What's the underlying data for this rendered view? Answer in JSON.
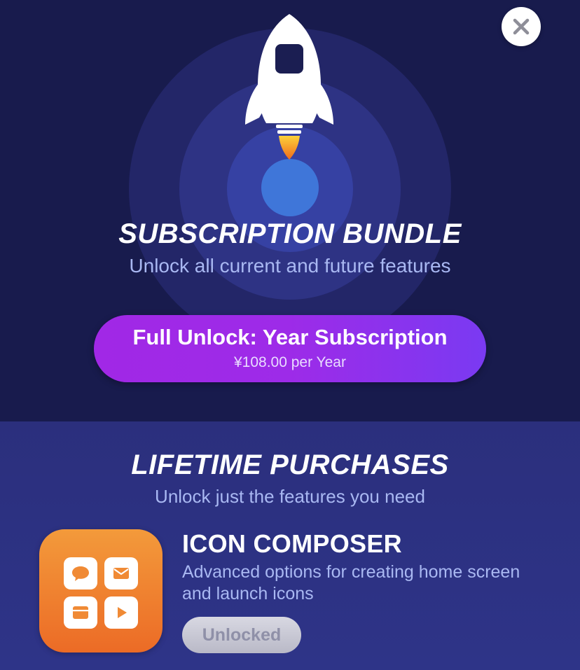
{
  "subscription": {
    "title": "SUBSCRIPTION BUNDLE",
    "subtitle": "Unlock all current and future features",
    "button_label": "Full Unlock: Year Subscription",
    "button_price": "¥108.00 per Year"
  },
  "lifetime": {
    "title": "LIFETIME PURCHASES",
    "subtitle": "Unlock just the features you need",
    "products": [
      {
        "name": "ICON COMPOSER",
        "description": "Advanced options for creating home screen and launch icons",
        "status": "Unlocked",
        "icon": "icon-composer-icon"
      }
    ]
  },
  "icons": {
    "close": "close-icon",
    "hero": "rocket-icon"
  },
  "colors": {
    "background_top": "#181b4d",
    "background_bottom": "#2b2f7d",
    "accent_purple": "#a128e6",
    "accent_orange": "#ec6b26",
    "subtitle_text": "#a9b8f2"
  }
}
